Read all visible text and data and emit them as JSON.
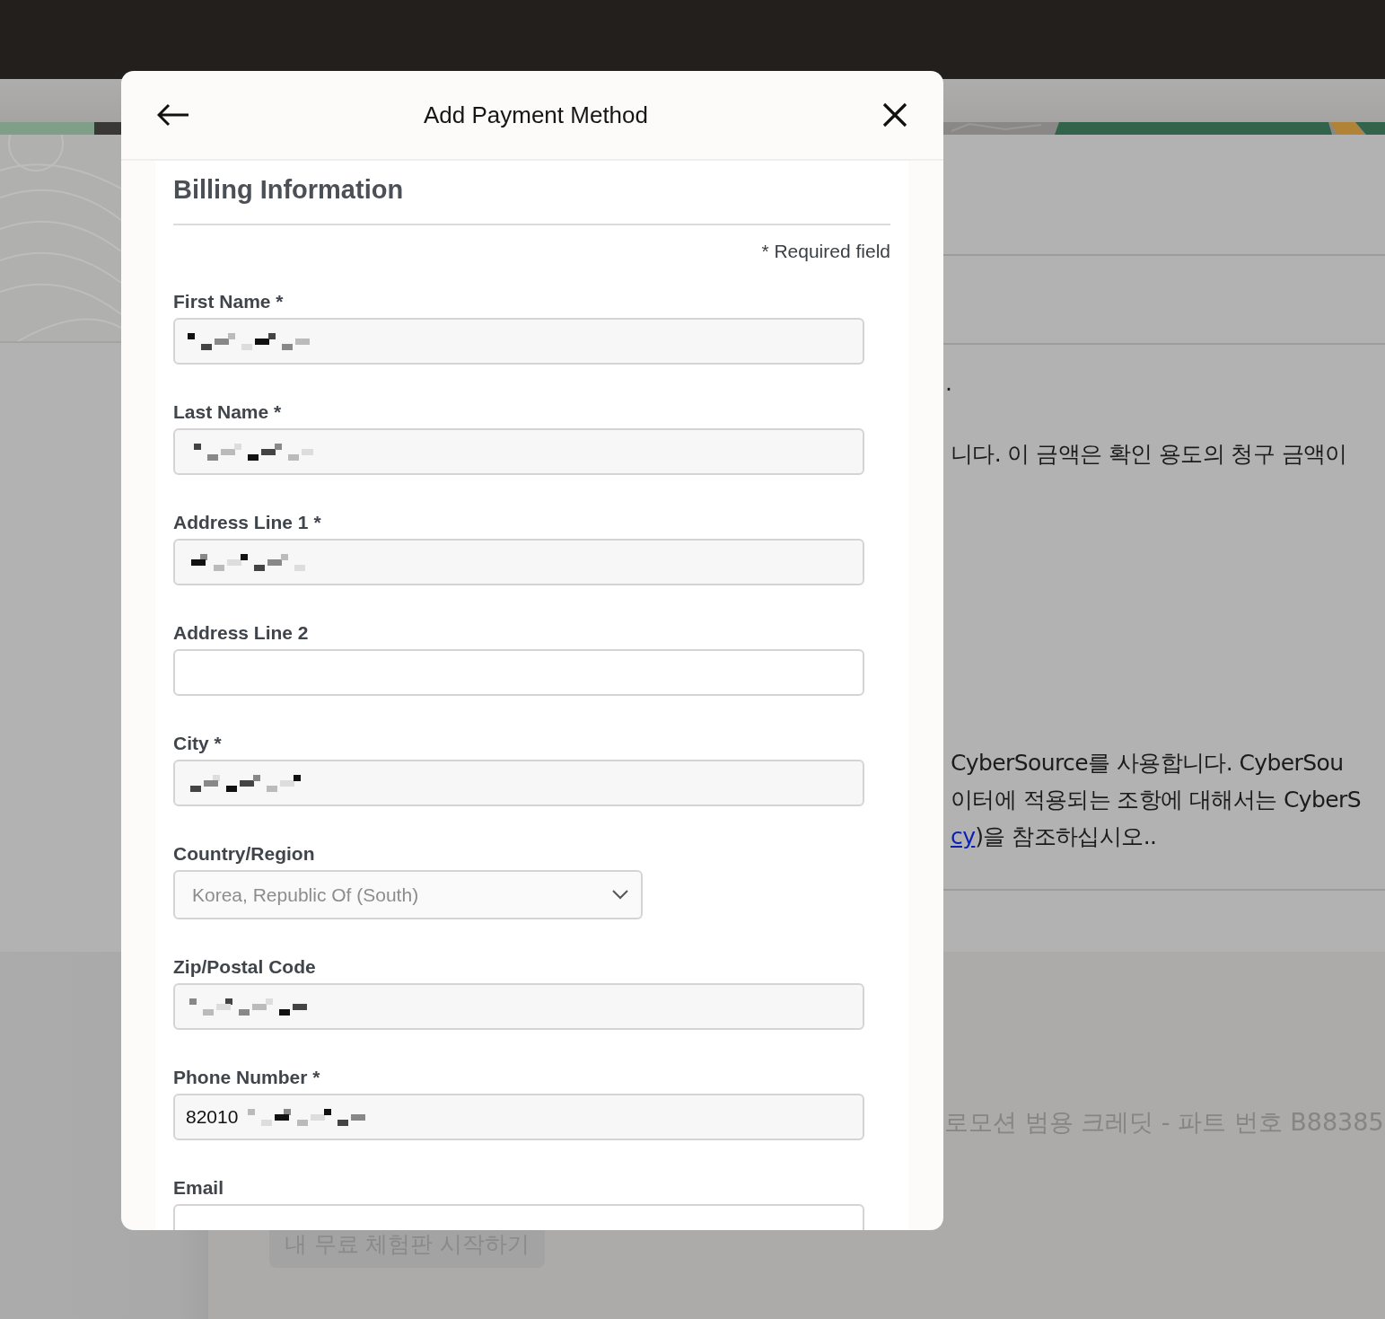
{
  "modal": {
    "title": "Add Payment Method",
    "section_title": "Billing Information",
    "required_note": "* Required field",
    "fields": [
      {
        "kind": "text",
        "label": "First Name *",
        "redacted": true
      },
      {
        "kind": "text",
        "label": "Last Name *",
        "redacted": true
      },
      {
        "kind": "text",
        "label": "Address Line 1 *",
        "redacted": true
      },
      {
        "kind": "text",
        "label": "Address Line 2",
        "redacted": false
      },
      {
        "kind": "text",
        "label": "City *",
        "redacted": true
      },
      {
        "kind": "select",
        "label": "Country/Region",
        "value": "Korea, Republic Of (South)",
        "redacted": false
      },
      {
        "kind": "text",
        "label": "Zip/Postal Code",
        "redacted": true
      },
      {
        "kind": "text",
        "label": "Phone Number *",
        "value": "82010",
        "redacted": true
      },
      {
        "kind": "text",
        "label": "Email",
        "redacted": false
      }
    ]
  },
  "background": {
    "line_1": ".",
    "line_2": "니다. 이 금액은 확인 용도의 청구 금액이",
    "notice": {
      "line_1": "CyberSource를 사용합니다. CyberSou",
      "line_2": "이터에 적용되는 조항에 대해서는 CyberS",
      "link": "cy",
      "line_3_rest": ")을 참조하십시오.."
    },
    "promo": "로모션 범용 크레딧 - 파트 번호 B88385",
    "trial_button": "내 무료 체험판 시작하기"
  }
}
